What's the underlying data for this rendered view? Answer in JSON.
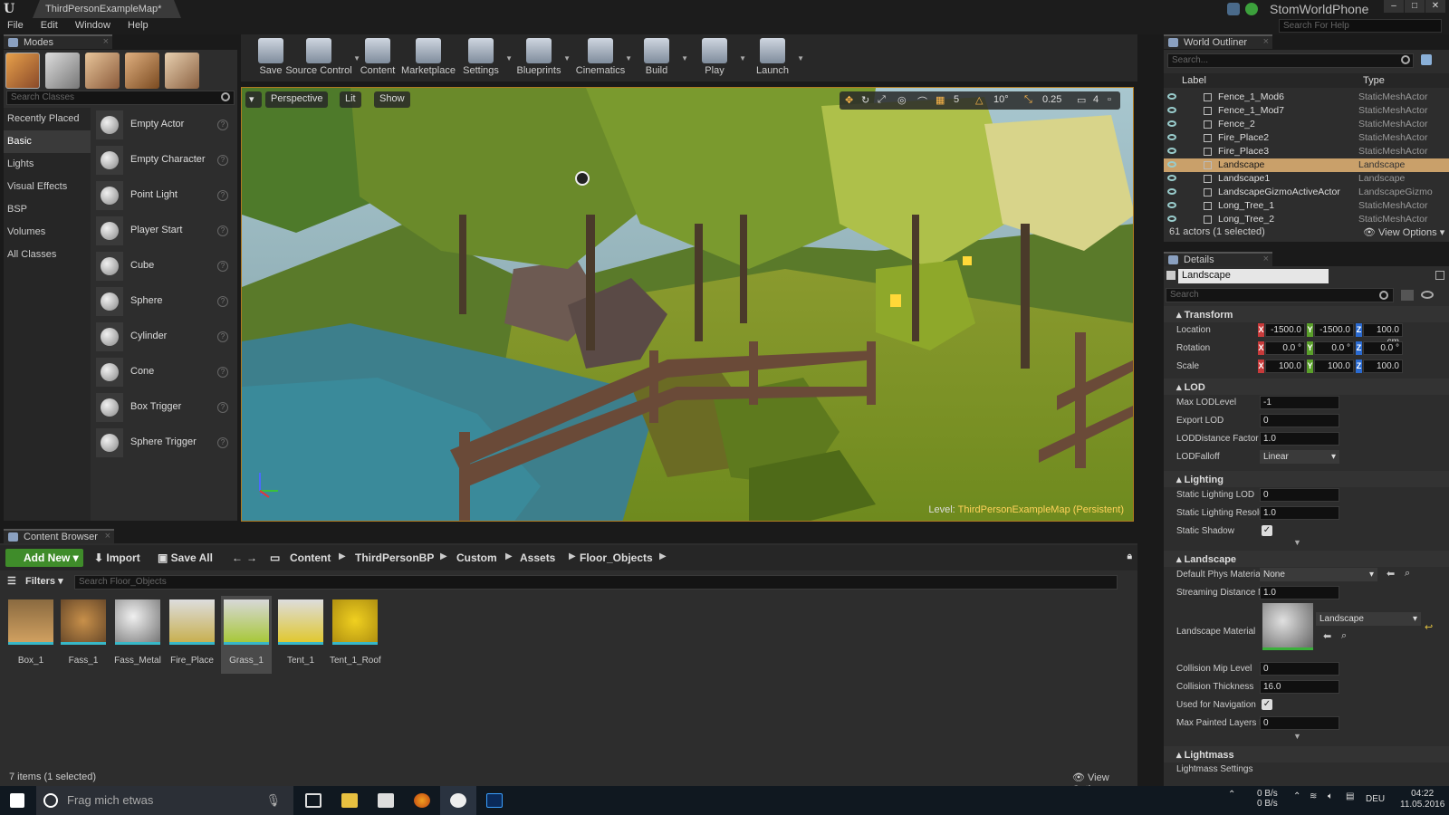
{
  "window": {
    "doc_tab": "ThirdPersonExampleMap*",
    "project": "StomWorldPhone",
    "search_help_placeholder": "Search For Help"
  },
  "menu": [
    "File",
    "Edit",
    "Window",
    "Help"
  ],
  "modes": {
    "tab": "Modes",
    "search_placeholder": "Search Classes",
    "categories": [
      "Recently Placed",
      "Basic",
      "Lights",
      "Visual Effects",
      "BSP",
      "Volumes",
      "All Classes"
    ],
    "selected_category": "Basic",
    "actors": [
      "Empty Actor",
      "Empty Character",
      "Point Light",
      "Player Start",
      "Cube",
      "Sphere",
      "Cylinder",
      "Cone",
      "Box Trigger",
      "Sphere Trigger"
    ]
  },
  "toolbar": {
    "save": "Save",
    "source_control": "Source Control",
    "content": "Content",
    "marketplace": "Marketplace",
    "settings": "Settings",
    "blueprints": "Blueprints",
    "cinematics": "Cinematics",
    "build": "Build",
    "play": "Play",
    "launch": "Launch"
  },
  "viewport": {
    "perspective": "Perspective",
    "lit": "Lit",
    "show": "Show",
    "grid_snap": "5",
    "rot_snap": "10°",
    "scale_snap": "0.25",
    "cam_speed": "4",
    "level_prefix": "Level:",
    "level_name": "ThirdPersonExampleMap (Persistent)"
  },
  "content_browser": {
    "tab": "Content Browser",
    "add_new": "Add New",
    "import": "Import",
    "save_all": "Save All",
    "path": [
      "Content",
      "ThirdPersonBP",
      "Custom",
      "Assets",
      "Floor_Objects"
    ],
    "filters": "Filters",
    "search_placeholder": "Search Floor_Objects",
    "assets": [
      "Box_1",
      "Fass_1",
      "Fass_Metal",
      "Fire_Place",
      "Grass_1",
      "Tent_1",
      "Tent_1_Roof"
    ],
    "selected_asset": "Grass_1",
    "status": "7 items (1 selected)",
    "view_options": "View Options"
  },
  "outliner": {
    "tab": "World Outliner",
    "search_placeholder": "Search...",
    "col_label": "Label",
    "col_type": "Type",
    "rows": [
      {
        "label": "Fence_1_Mod6",
        "type": "StaticMeshActor"
      },
      {
        "label": "Fence_1_Mod7",
        "type": "StaticMeshActor"
      },
      {
        "label": "Fence_2",
        "type": "StaticMeshActor"
      },
      {
        "label": "Fire_Place2",
        "type": "StaticMeshActor"
      },
      {
        "label": "Fire_Place3",
        "type": "StaticMeshActor"
      },
      {
        "label": "Landscape",
        "type": "Landscape"
      },
      {
        "label": "Landscape1",
        "type": "Landscape"
      },
      {
        "label": "LandscapeGizmoActiveActor",
        "type": "LandscapeGizmo"
      },
      {
        "label": "Long_Tree_1",
        "type": "StaticMeshActor"
      },
      {
        "label": "Long_Tree_2",
        "type": "StaticMeshActor"
      }
    ],
    "selected_row": "Landscape",
    "footer": "61 actors (1 selected)",
    "view_options": "View Options"
  },
  "details": {
    "tab": "Details",
    "name": "Landscape",
    "search_placeholder": "Search",
    "transform": {
      "title": "Transform",
      "location_label": "Location",
      "rotation_label": "Rotation",
      "scale_label": "Scale",
      "location": [
        "-1500.0",
        "-1500.0",
        "100.0 cm"
      ],
      "rotation": [
        "0.0 °",
        "0.0 °",
        "0.0 °"
      ],
      "scale": [
        "100.0",
        "100.0",
        "100.0"
      ]
    },
    "lod": {
      "title": "LOD",
      "max_lod_label": "Max LODLevel",
      "max_lod": "-1",
      "export_lod_label": "Export LOD",
      "export_lod": "0",
      "lod_distance_label": "LODDistance Factor",
      "lod_distance": "1.0",
      "lod_falloff_label": "LODFalloff",
      "lod_falloff": "Linear"
    },
    "lighting": {
      "title": "Lighting",
      "static_lod_label": "Static Lighting LOD",
      "static_lod": "0",
      "static_res_label": "Static Lighting Resolu",
      "static_res": "1.0",
      "static_shadow_label": "Static Shadow",
      "static_shadow": true
    },
    "landscape": {
      "title": "Landscape",
      "phys_mat_label": "Default Phys Material",
      "phys_mat": "None",
      "stream_dist_label": "Streaming Distance M",
      "stream_dist": "1.0",
      "material_label": "Landscape Material",
      "material": "Landscape",
      "coll_mip_label": "Collision Mip Level",
      "coll_mip": "0",
      "coll_thick_label": "Collision Thickness",
      "coll_thick": "16.0",
      "nav_label": "Used for Navigation",
      "nav": true,
      "max_painted_label": "Max Painted Layers P",
      "max_painted": "0"
    },
    "lightmass": {
      "title": "Lightmass",
      "settings": "Lightmass Settings"
    }
  },
  "taskbar": {
    "search_placeholder": "Frag mich etwas",
    "net_up": "0 B/s",
    "net_down": "0 B/s",
    "lang": "DEU",
    "time": "04:22",
    "date": "11.05.2016"
  }
}
